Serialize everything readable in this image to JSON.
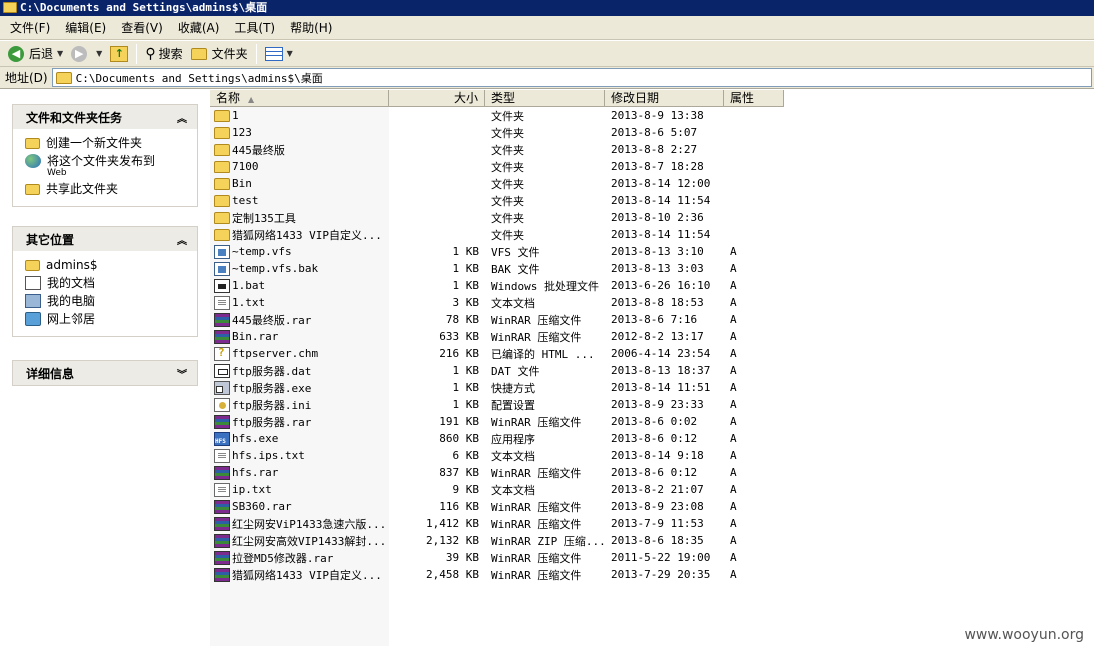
{
  "window": {
    "title": "C:\\Documents and Settings\\admins$\\桌面"
  },
  "menu": [
    "文件(F)",
    "编辑(E)",
    "查看(V)",
    "收藏(A)",
    "工具(T)",
    "帮助(H)"
  ],
  "toolbar": {
    "back": "后退",
    "search": "搜索",
    "folders": "文件夹"
  },
  "address": {
    "label": "地址(D)",
    "value": "C:\\Documents and Settings\\admins$\\桌面"
  },
  "tasks": {
    "file_tasks": {
      "title": "文件和文件夹任务",
      "items": [
        {
          "label": "创建一个新文件夹"
        },
        {
          "label": "将这个文件夹发布到",
          "sub": "Web"
        },
        {
          "label": "共享此文件夹"
        }
      ]
    },
    "other_places": {
      "title": "其它位置",
      "items": [
        {
          "label": "admins$"
        },
        {
          "label": "我的文档"
        },
        {
          "label": "我的电脑"
        },
        {
          "label": "网上邻居"
        }
      ]
    },
    "details": {
      "title": "详细信息"
    }
  },
  "columns": {
    "name": "名称",
    "size": "大小",
    "type": "类型",
    "date": "修改日期",
    "attr": "属性"
  },
  "files": [
    {
      "icon": "folder",
      "name": "1",
      "size": "",
      "type": "文件夹",
      "date": "2013-8-9 13:38",
      "attr": ""
    },
    {
      "icon": "folder",
      "name": "123",
      "size": "",
      "type": "文件夹",
      "date": "2013-8-6 5:07",
      "attr": ""
    },
    {
      "icon": "folder",
      "name": "445最终版",
      "size": "",
      "type": "文件夹",
      "date": "2013-8-8 2:27",
      "attr": ""
    },
    {
      "icon": "folder",
      "name": "7100",
      "size": "",
      "type": "文件夹",
      "date": "2013-8-7 18:28",
      "attr": ""
    },
    {
      "icon": "folder",
      "name": "Bin",
      "size": "",
      "type": "文件夹",
      "date": "2013-8-14 12:00",
      "attr": ""
    },
    {
      "icon": "folder",
      "name": "test",
      "size": "",
      "type": "文件夹",
      "date": "2013-8-14 11:54",
      "attr": ""
    },
    {
      "icon": "folder",
      "name": "定制135工具",
      "size": "",
      "type": "文件夹",
      "date": "2013-8-10 2:36",
      "attr": ""
    },
    {
      "icon": "folder",
      "name": "猎狐网络1433 VIP自定义...",
      "size": "",
      "type": "文件夹",
      "date": "2013-8-14 11:54",
      "attr": ""
    },
    {
      "icon": "vfs",
      "name": "~temp.vfs",
      "size": "1 KB",
      "type": "VFS 文件",
      "date": "2013-8-13 3:10",
      "attr": "A"
    },
    {
      "icon": "vfs",
      "name": "~temp.vfs.bak",
      "size": "1 KB",
      "type": "BAK 文件",
      "date": "2013-8-13 3:03",
      "attr": "A"
    },
    {
      "icon": "bat",
      "name": "1.bat",
      "size": "1 KB",
      "type": "Windows 批处理文件",
      "date": "2013-6-26 16:10",
      "attr": "A"
    },
    {
      "icon": "txt",
      "name": "1.txt",
      "size": "3 KB",
      "type": "文本文档",
      "date": "2013-8-8 18:53",
      "attr": "A"
    },
    {
      "icon": "rar",
      "name": "445最终版.rar",
      "size": "78 KB",
      "type": "WinRAR 压缩文件",
      "date": "2013-8-6 7:16",
      "attr": "A"
    },
    {
      "icon": "rar",
      "name": "Bin.rar",
      "size": "633 KB",
      "type": "WinRAR 压缩文件",
      "date": "2012-8-2 13:17",
      "attr": "A"
    },
    {
      "icon": "chm",
      "name": "ftpserver.chm",
      "size": "216 KB",
      "type": "已编译的 HTML ...",
      "date": "2006-4-14 23:54",
      "attr": "A"
    },
    {
      "icon": "dat",
      "name": "ftp服务器.dat",
      "size": "1 KB",
      "type": "DAT 文件",
      "date": "2013-8-13 18:37",
      "attr": "A"
    },
    {
      "icon": "lnk",
      "name": "ftp服务器.exe",
      "size": "1 KB",
      "type": "快捷方式",
      "date": "2013-8-14 11:51",
      "attr": "A"
    },
    {
      "icon": "ini",
      "name": "ftp服务器.ini",
      "size": "1 KB",
      "type": "配置设置",
      "date": "2013-8-9 23:33",
      "attr": "A"
    },
    {
      "icon": "rar",
      "name": "ftp服务器.rar",
      "size": "191 KB",
      "type": "WinRAR 压缩文件",
      "date": "2013-8-6 0:02",
      "attr": "A"
    },
    {
      "icon": "exe",
      "name": "hfs.exe",
      "size": "860 KB",
      "type": "应用程序",
      "date": "2013-8-6 0:12",
      "attr": "A"
    },
    {
      "icon": "txt",
      "name": "hfs.ips.txt",
      "size": "6 KB",
      "type": "文本文档",
      "date": "2013-8-14 9:18",
      "attr": "A"
    },
    {
      "icon": "rar",
      "name": "hfs.rar",
      "size": "837 KB",
      "type": "WinRAR 压缩文件",
      "date": "2013-8-6 0:12",
      "attr": "A"
    },
    {
      "icon": "txt",
      "name": "ip.txt",
      "size": "9 KB",
      "type": "文本文档",
      "date": "2013-8-2 21:07",
      "attr": "A"
    },
    {
      "icon": "rar",
      "name": "SB360.rar",
      "size": "116 KB",
      "type": "WinRAR 压缩文件",
      "date": "2013-8-9 23:08",
      "attr": "A"
    },
    {
      "icon": "rar",
      "name": "红尘网安ViP1433急速六版...",
      "size": "1,412 KB",
      "type": "WinRAR 压缩文件",
      "date": "2013-7-9 11:53",
      "attr": "A"
    },
    {
      "icon": "rar",
      "name": "红尘网安高效VIP1433解封...",
      "size": "2,132 KB",
      "type": "WinRAR ZIP 压缩...",
      "date": "2013-8-6 18:35",
      "attr": "A"
    },
    {
      "icon": "rar",
      "name": "拉登MD5修改器.rar",
      "size": "39 KB",
      "type": "WinRAR 压缩文件",
      "date": "2011-5-22 19:00",
      "attr": "A"
    },
    {
      "icon": "rar",
      "name": "猎狐网络1433 VIP自定义...",
      "size": "2,458 KB",
      "type": "WinRAR 压缩文件",
      "date": "2013-7-29 20:35",
      "attr": "A"
    }
  ],
  "watermark": "www.wooyun.org"
}
